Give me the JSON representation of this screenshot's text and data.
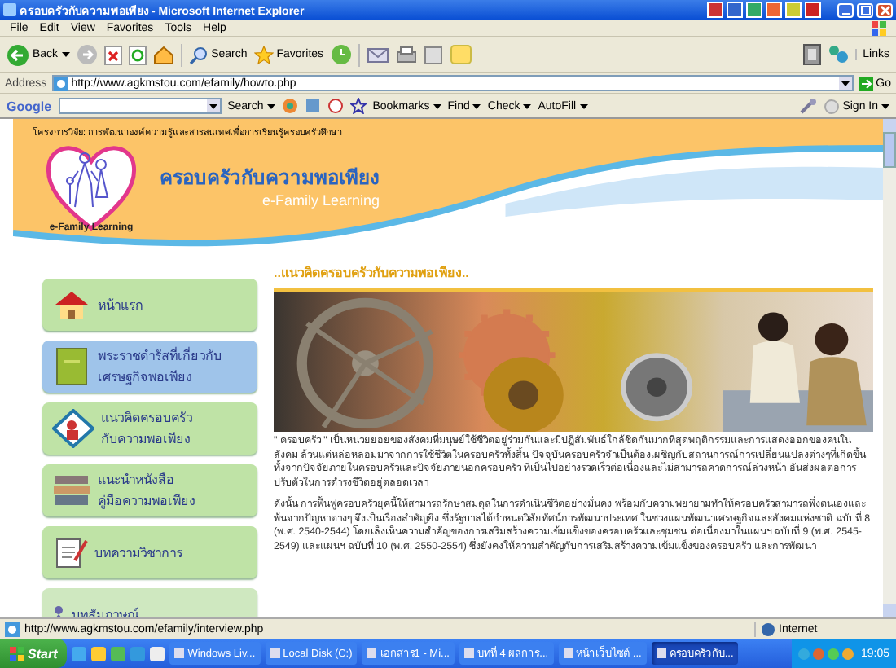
{
  "window": {
    "title": "ครอบครัวกับความพอเพียง - Microsoft Internet Explorer"
  },
  "menu": [
    "File",
    "Edit",
    "View",
    "Favorites",
    "Tools",
    "Help"
  ],
  "toolbar": {
    "back": "Back",
    "search": "Search",
    "favorites": "Favorites",
    "links": "Links"
  },
  "address": {
    "label": "Address",
    "value": "http://www.agkmstou.com/efamily/howto.php",
    "go": "Go"
  },
  "google_bar": {
    "logo": "Google",
    "items": [
      "Search",
      "Bookmarks",
      "Find",
      "Check",
      "AutoFill"
    ],
    "sign_in": "Sign In"
  },
  "header": {
    "project": "โครงการวิจัย: การพัฒนาองค์ความรู้และสารสนเทศเพื่อการเรียนรู้ครอบครัวศึกษา",
    "logo_caption": "e-Family Learning",
    "site_title": "ครอบครัวกับความพอเพียง",
    "subtitle": "e-Family Learning"
  },
  "sidebar": {
    "items": [
      {
        "kind": "home",
        "lines": [
          "หน้าแรก"
        ]
      },
      {
        "kind": "book",
        "lines": [
          "พระราชดำรัสที่เกี่ยวกับ",
          "เศรษฐกิจพอเพียง"
        ]
      },
      {
        "kind": "sign",
        "lines": [
          "แนวคิดครอบครัว",
          "กับความพอเพียง"
        ]
      },
      {
        "kind": "books",
        "lines": [
          "แนะนำหนังสือ",
          "คู่มือความพอเพียง"
        ]
      },
      {
        "kind": "article",
        "lines": [
          "บทความวิชาการ"
        ]
      },
      {
        "kind": "interview",
        "lines": [
          "บทสัมภาษณ์"
        ]
      }
    ]
  },
  "content": {
    "heading": "..แนวคิดครอบครัวกับความพอเพียง..",
    "paragraphs": [
      "\" ครอบครัว \" เป็นหน่วยย่อยของสังคมที่มนุษย์ใช้ชีวิตอยู่ร่วมกันและมีปฏิสัมพันธ์ใกล้ชิดกันมากที่สุดพฤติกรรมและการแสดงออกของคนในสังคม ล้วนแต่หล่อหลอมมาจากการใช้ชีวิตในครอบครัวทั้งสิ้น ปัจจุบันครอบครัวจำเป็นต้องเผชิญกับสถานการณ์การเปลี่ยนแปลงต่างๆที่เกิดขึ้นทั้งจากปัจจัยภายในครอบครัวและปัจจัยภายนอกครอบครัว ที่เป็นไปอย่างรวดเร็วต่อเนื่องและไม่สามารถคาดการณ์ล่วงหน้า อันส่งผลต่อการปรับตัวในการดำรงชีวิตอยู่ตลอดเวลา",
      "ดังนั้น การฟื้นฟูครอบครัวยุคนี้ให้สามารถรักษาสมดุลในการดำเนินชีวิตอย่างมั่นคง พร้อมกับความพยายามทำให้ครอบครัวสามารถพึ่งตนเองและพ้นจากปัญหาต่างๆ จึงเป็นเรื่องสำคัญยิ่ง ซึ่งรัฐบาลได้กำหนดวิสัยทัศน์การพัฒนาประเทศ ในช่วงแผนพัฒนาเศรษฐกิจและสังคมแห่งชาติ ฉบับที่ 8 (พ.ศ. 2540-2544) โดยเล็งเห็นความสำคัญของการเสริมสร้างความเข้มแข็งของครอบครัวและชุมชน ต่อเนื่องมาในแผนฯ ฉบับที่ 9 (พ.ศ. 2545-2549) และแผนฯ ฉบับที่ 10 (พ.ศ. 2550-2554) ซึ่งยังคงให้ความสำคัญกับการเสริมสร้างความเข้มแข็งของครอบครัว และการพัฒนา"
    ]
  },
  "status_bar": {
    "url": "http://www.agkmstou.com/efamily/interview.php",
    "zone": "Internet"
  },
  "taskbar": {
    "start": "Start",
    "tasks": [
      {
        "label": "Windows Liv...",
        "selected": false
      },
      {
        "label": "Local Disk (C:)",
        "selected": false
      },
      {
        "label": "เอกสาร1 - Mi...",
        "selected": false
      },
      {
        "label": "บทที่ 4 ผลการ...",
        "selected": false
      },
      {
        "label": "หน้าเว็บไซต์ ...",
        "selected": false
      },
      {
        "label": "ครอบครัวกับ...",
        "selected": true
      }
    ],
    "clock": "19:05"
  }
}
